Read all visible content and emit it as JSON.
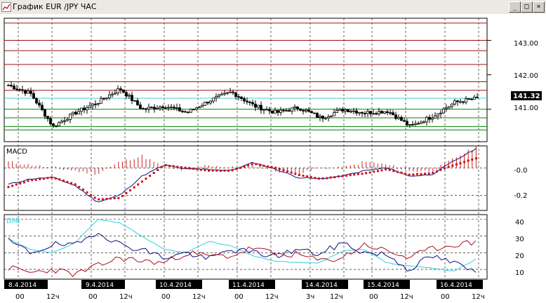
{
  "window": {
    "title": "График EUR /JPY  ЧАС",
    "btn_min": "_",
    "btn_max": "□",
    "btn_close": "×"
  },
  "price_panel": {
    "y_ticks": [
      "143.00",
      "142.00",
      "141.00"
    ],
    "current_price": "141.32",
    "ylim": [
      140.1,
      143.6
    ]
  },
  "macd_panel": {
    "label": "MACD",
    "y_ticks": [
      "-0.0",
      "-0.2"
    ]
  },
  "dmi_panel": {
    "label": "DMI",
    "y_ticks": [
      "40",
      "30",
      "20",
      "10"
    ]
  },
  "x_axis": {
    "dates": [
      "8.4.2014",
      "9.4.2014",
      "10.4.2014",
      "11.4.2014",
      "14.4.2014",
      "15.4.2014",
      "16.4.2014"
    ],
    "hour_labels": [
      [
        "00",
        "12ч"
      ],
      [
        "00",
        "12ч"
      ],
      [
        "00",
        "12ч"
      ],
      [
        "00",
        "12ч"
      ],
      [
        "3ч",
        "12ч"
      ],
      [
        "00",
        "12ч"
      ],
      [
        "00",
        "12ч"
      ]
    ]
  },
  "colors": {
    "resistance": "#a01010",
    "current_line": "#40d0d0",
    "support": "#008000",
    "macd_line": "#101080",
    "signal_line": "#cc1010",
    "histogram": "#cc2020",
    "plus_di": "#101080",
    "minus_di": "#aa1020",
    "adx": "#30d0e0"
  },
  "chart_data": [
    {
      "type": "line",
      "name_hint": "candlestick price",
      "x": [
        "8.4.2014",
        "9.4.2014",
        "10.4.2014",
        "11.4.2014",
        "14.4.2014",
        "15.4.2014",
        "16.4.2014"
      ],
      "ohlc_close": [
        141.7,
        141.45,
        140.5,
        140.9,
        141.2,
        141.6,
        141.0,
        141.1,
        140.9,
        141.25,
        141.5,
        141.1,
        140.9,
        141.05,
        140.75,
        141.0,
        140.9,
        140.95,
        140.5,
        140.8,
        141.2,
        141.32
      ],
      "ylim": [
        140.1,
        143.6
      ],
      "horizontal_levels": {
        "resistance": [
          143.5,
          143.0,
          142.7,
          142.3,
          141.8,
          141.55
        ],
        "current": 141.32,
        "support": [
          141.0,
          140.75,
          140.5,
          140.4
        ]
      }
    },
    {
      "type": "line",
      "name_hint": "MACD",
      "series": [
        {
          "values": [
            -0.12,
            -0.08,
            -0.07,
            -0.13,
            -0.25,
            -0.2,
            -0.06,
            0.02,
            -0.01,
            -0.01,
            -0.02,
            0.04,
            -0.01,
            -0.07,
            -0.08,
            -0.06,
            -0.02,
            0.0,
            -0.06,
            -0.05,
            0.05,
            0.14
          ]
        },
        {
          "values": [
            -0.14,
            -0.09,
            -0.07,
            -0.12,
            -0.23,
            -0.22,
            -0.1,
            0.02,
            0.0,
            -0.02,
            -0.02,
            0.03,
            0.0,
            -0.05,
            -0.08,
            -0.06,
            -0.04,
            -0.01,
            -0.05,
            -0.04,
            0.02,
            0.07
          ]
        }
      ],
      "ylim": [
        -0.3,
        0.15
      ]
    },
    {
      "type": "line",
      "name_hint": "DMI",
      "series": [
        {
          "values": [
            27,
            20,
            25,
            24,
            33,
            25,
            22,
            17,
            20,
            16,
            22,
            20,
            18,
            22,
            19,
            26,
            20,
            19,
            10,
            18,
            14,
            8
          ]
        },
        {
          "values": [
            11,
            8,
            10,
            7,
            12,
            17,
            15,
            14,
            20,
            18,
            18,
            23,
            19,
            19,
            15,
            17,
            25,
            21,
            17,
            22,
            25,
            26
          ]
        },
        {
          "values": [
            28,
            22,
            20,
            26,
            40,
            38,
            30,
            22,
            20,
            27,
            24,
            18,
            15,
            14,
            14,
            21,
            22,
            14,
            12,
            11,
            9,
            16
          ]
        }
      ],
      "ylim": [
        5,
        42
      ]
    }
  ]
}
